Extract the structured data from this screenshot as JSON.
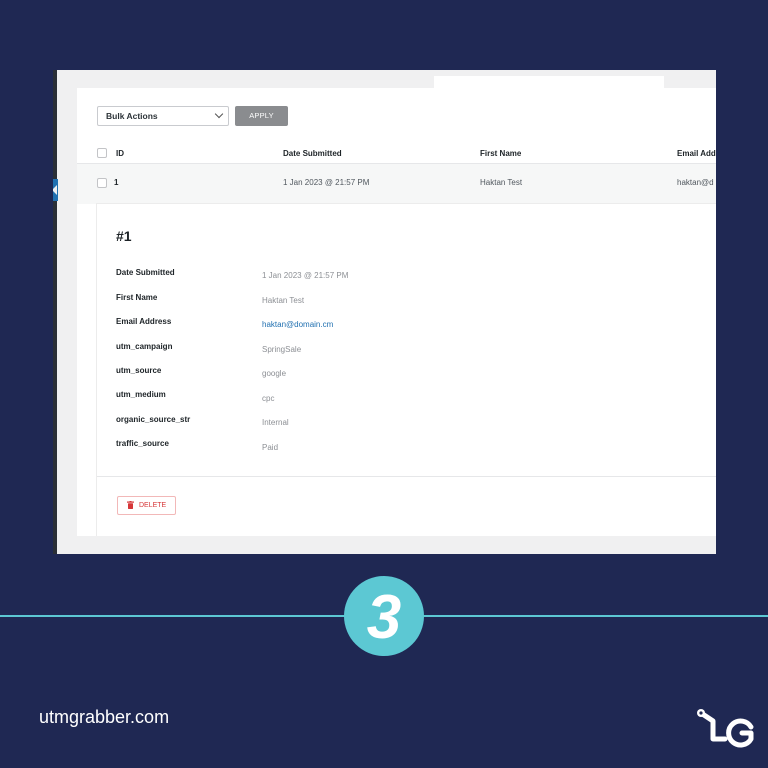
{
  "toolbar": {
    "bulk_actions_label": "Bulk Actions",
    "apply_label": "APPLY"
  },
  "table": {
    "columns": [
      "ID",
      "Date Submitted",
      "First Name",
      "Email Addr"
    ],
    "rows": [
      {
        "id": "1",
        "date": "1 Jan 2023 @ 21:57 PM",
        "first_name": "Haktan Test",
        "email": "haktan@d"
      }
    ]
  },
  "detail": {
    "title": "#1",
    "fields": [
      {
        "label": "Date Submitted",
        "value": "1 Jan 2023 @ 21:57 PM"
      },
      {
        "label": "First Name",
        "value": "Haktan Test"
      },
      {
        "label": "Email Address",
        "value": "haktan@domain.cm"
      },
      {
        "label": "utm_campaign",
        "value": "SpringSale"
      },
      {
        "label": "utm_source",
        "value": "google"
      },
      {
        "label": "utm_medium",
        "value": "cpc"
      },
      {
        "label": "organic_source_str",
        "value": "Internal"
      },
      {
        "label": "traffic_source",
        "value": "Paid"
      }
    ],
    "delete_label": "DELETE"
  },
  "step": {
    "number": "3"
  },
  "footer": {
    "site_url": "utmgrabber.com"
  },
  "colors": {
    "background": "#1f2853",
    "accent": "#5cc8d3",
    "link": "#2271b1",
    "danger": "#d63638"
  },
  "icons": [
    "chevron-down-icon",
    "trash-icon",
    "utmgrabber-logo-icon"
  ]
}
